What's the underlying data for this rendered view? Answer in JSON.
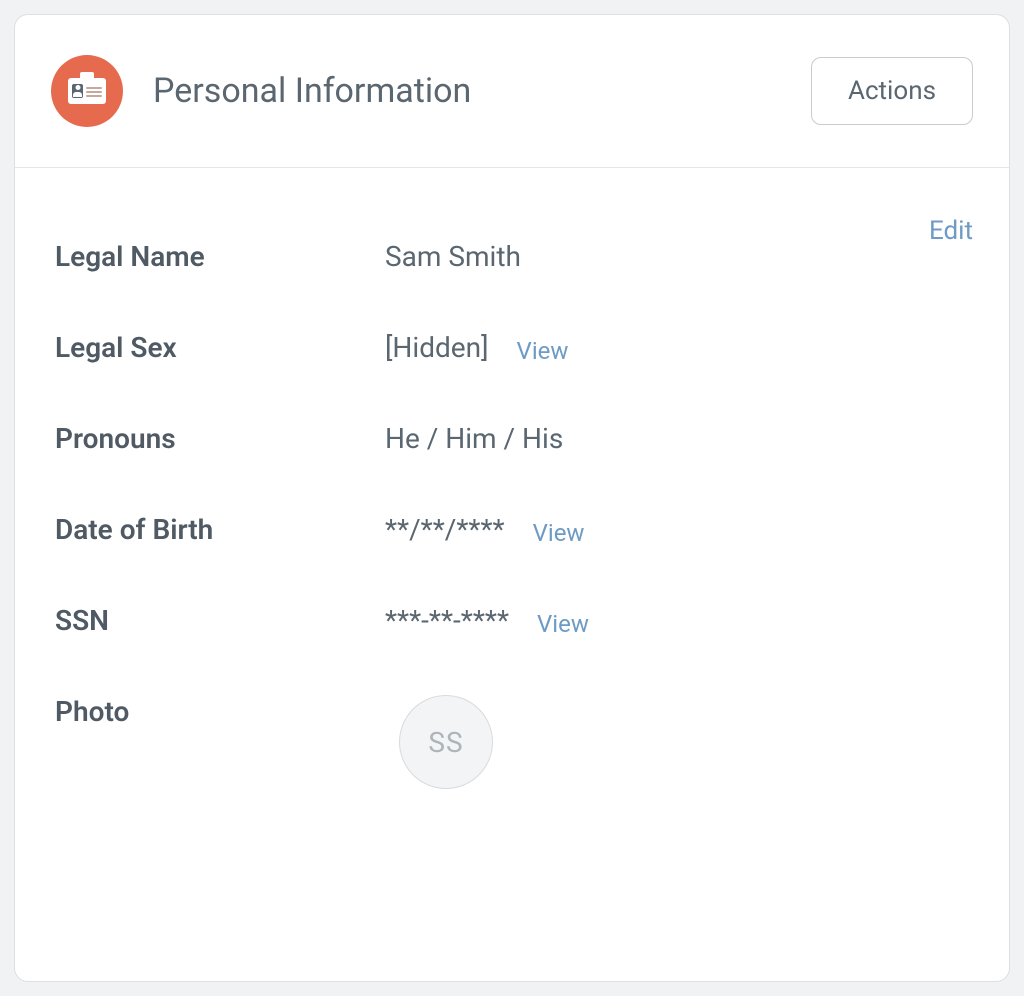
{
  "header": {
    "title": "Personal Information",
    "actions_label": "Actions"
  },
  "edit_label": "Edit",
  "view_label": "View",
  "fields": {
    "legal_name": {
      "label": "Legal Name",
      "value": "Sam Smith"
    },
    "legal_sex": {
      "label": "Legal Sex",
      "value": "[Hidden]"
    },
    "pronouns": {
      "label": "Pronouns",
      "value": "He / Him / His"
    },
    "dob": {
      "label": "Date of Birth",
      "value": "**/**/****"
    },
    "ssn": {
      "label": "SSN",
      "value": "***-**-****"
    },
    "photo": {
      "label": "Photo",
      "initials": "SS"
    }
  }
}
